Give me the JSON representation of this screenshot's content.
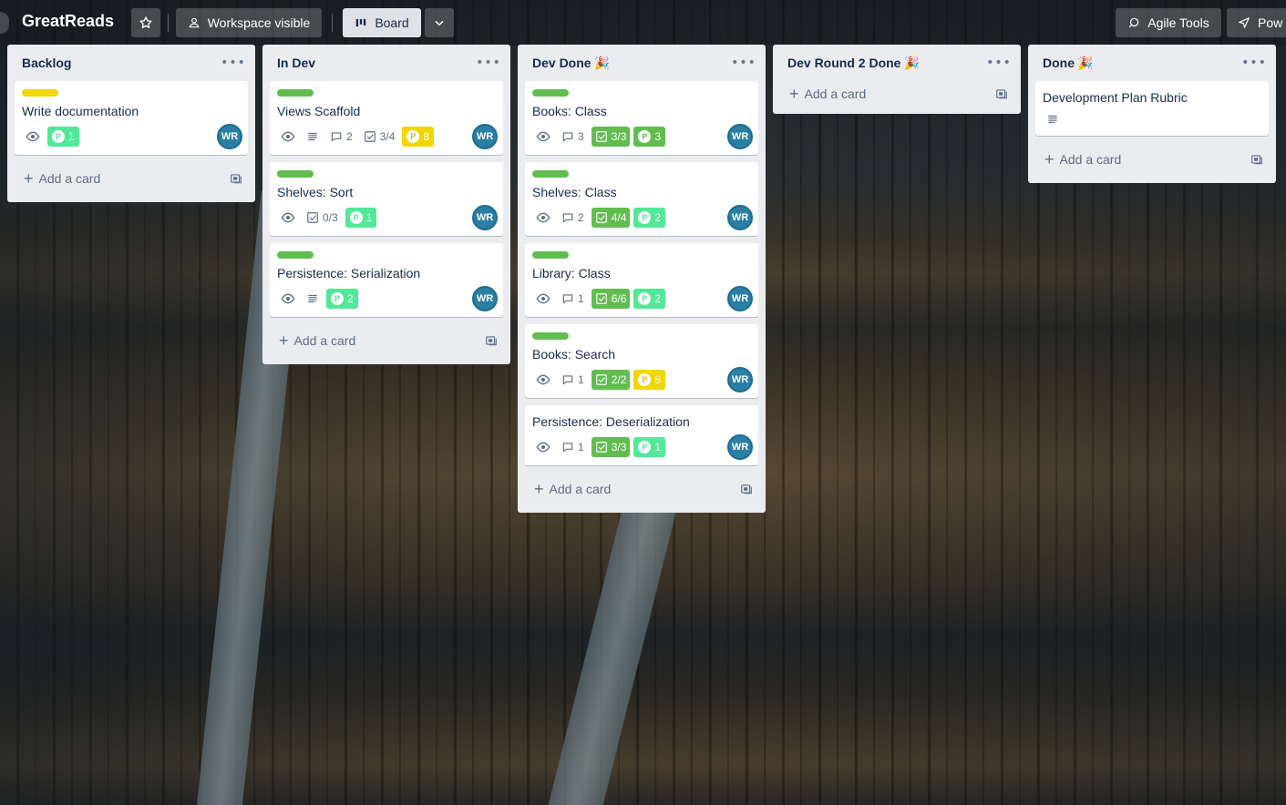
{
  "header": {
    "board_title": "GreatReads",
    "visibility_label": "Workspace visible",
    "view_label": "Board",
    "agile_tools_label": "Agile Tools",
    "power_ups_label": "Pow"
  },
  "colors": {
    "label_yellow": "#f2d600",
    "label_green": "#61bd4f",
    "points_teal": "#51e898",
    "points_yellow": "#f2d600",
    "avatar_blue": "#2a7fa5"
  },
  "add_card_label": "Add a card",
  "avatar_initials": "WR",
  "lists": [
    {
      "title": "Backlog",
      "cards": [
        {
          "title": "Write documentation",
          "label": "yellow",
          "points": "1",
          "points_color": "teal"
        }
      ]
    },
    {
      "title": "In Dev",
      "cards": [
        {
          "title": "Views Scaffold",
          "label": "green",
          "comments": "2",
          "checklist": "3/4",
          "points": "8",
          "points_color": "yellow"
        },
        {
          "title": "Shelves: Sort",
          "label": "green",
          "checklist": "0/3",
          "points": "1",
          "points_color": "teal"
        },
        {
          "title": "Persistence: Serialization",
          "label": "green",
          "points": "2",
          "points_color": "teal"
        }
      ]
    },
    {
      "title": "Dev Done",
      "emoji": "🎉",
      "cards": [
        {
          "title": "Books: Class",
          "label": "green",
          "comments": "3",
          "checklist": "3/3",
          "points": "3",
          "points_color": "green"
        },
        {
          "title": "Shelves: Class",
          "label": "green",
          "comments": "2",
          "checklist": "4/4",
          "points": "2",
          "points_color": "teal"
        },
        {
          "title": "Library: Class",
          "label": "green",
          "comments": "1",
          "checklist": "6/6",
          "points": "2",
          "points_color": "teal"
        },
        {
          "title": "Books: Search",
          "label": "green",
          "comments": "1",
          "checklist": "2/2",
          "points": "8",
          "points_color": "yellow"
        },
        {
          "title": "Persistence: Deserialization",
          "comments": "1",
          "checklist": "3/3",
          "points": "1",
          "points_color": "teal"
        }
      ]
    },
    {
      "title": "Dev Round 2 Done",
      "emoji": "🎉",
      "cards": []
    },
    {
      "title": "Done",
      "emoji": "🎉",
      "cards": [
        {
          "title": "Development Plan Rubric"
        }
      ]
    }
  ]
}
